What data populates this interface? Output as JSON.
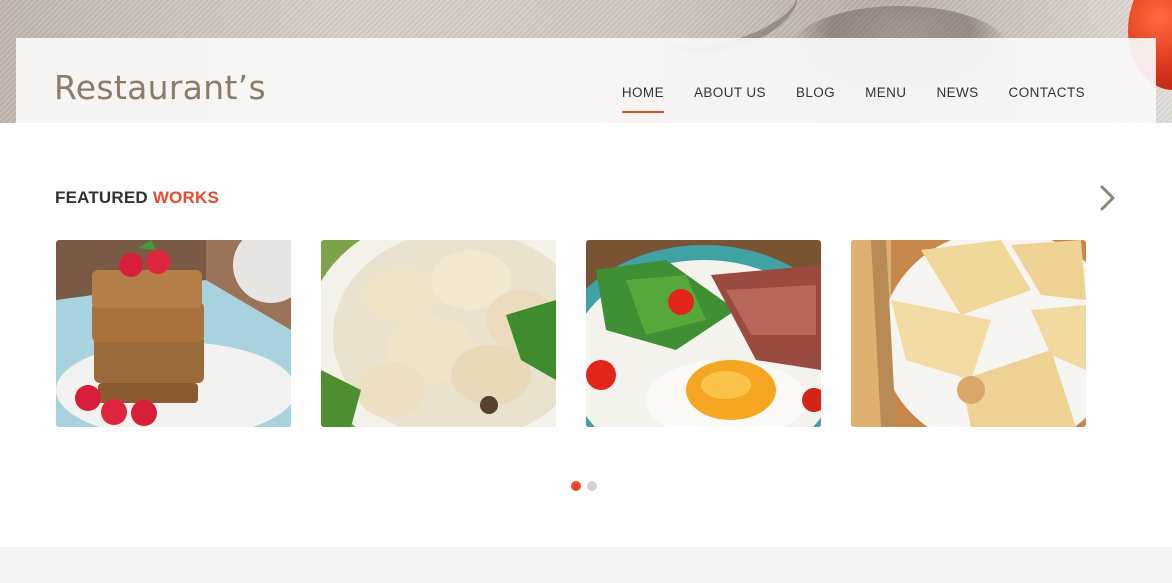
{
  "brand": {
    "logo_text": "Restaurant’s"
  },
  "nav": {
    "items": [
      {
        "label": "HOME",
        "active": true
      },
      {
        "label": "ABOUT US",
        "active": false
      },
      {
        "label": "BLOG",
        "active": false
      },
      {
        "label": "MENU",
        "active": false
      },
      {
        "label": "NEWS",
        "active": false
      },
      {
        "label": "CONTACTS",
        "active": false
      }
    ]
  },
  "featured": {
    "title_part1": "FEATURED",
    "title_part2": "WORKS",
    "next_icon": "chevron-right-icon",
    "items": [
      {
        "image": "raspberry-cake-image"
      },
      {
        "image": "dumplings-image"
      },
      {
        "image": "fried-egg-meat-salad-image"
      },
      {
        "image": "pancakes-image"
      }
    ],
    "pagination": {
      "pages": 2,
      "current": 1
    }
  },
  "colors": {
    "accent": "#e64b2e",
    "logo": "#8c7b68",
    "text": "#333333",
    "dot_inactive": "#d3d3d3",
    "footer_band": "#f4f4f4"
  }
}
